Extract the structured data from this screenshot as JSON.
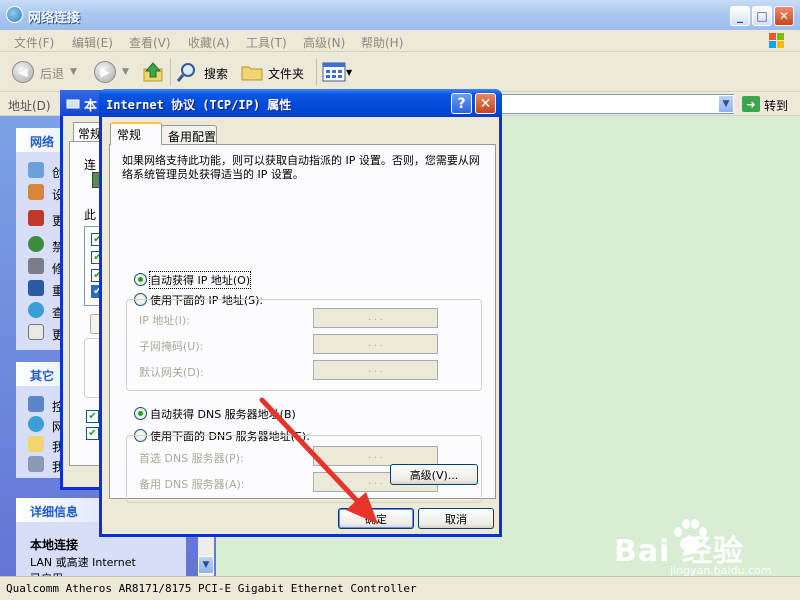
{
  "main_window": {
    "title": "网络连接",
    "menu": [
      "文件(F)",
      "编辑(E)",
      "查看(V)",
      "收藏(A)",
      "工具(T)",
      "高级(N)",
      "帮助(H)"
    ],
    "toolbar": {
      "back": "后退",
      "search": "搜索",
      "folders": "文件夹"
    },
    "address": {
      "label": "地址(D)",
      "value": "",
      "go": "转到"
    },
    "left_pane": {
      "network_tasks_title": "网络",
      "network_tasks_items": [
        "创",
        "设",
        "更",
        "禁",
        "修",
        "重",
        "查",
        "更"
      ],
      "other_places_title": "其它",
      "other_places_items": [
        "控",
        "网",
        "我",
        "我"
      ],
      "details_title": "详细信息",
      "details_name": "本地连接",
      "details_type": "LAN 或高速 Internet",
      "details_extra": "已启用"
    },
    "status_bar": "Qualcomm Atheros AR8171/8175 PCI-E Gigabit Ethernet Controller"
  },
  "back_dialog": {
    "title": "本",
    "tab": "常规",
    "connect_using": "连",
    "components_label": "此"
  },
  "dialog": {
    "title": "Internet 协议 (TCP/IP) 属性",
    "help": "?",
    "close": "✕",
    "tabs": [
      "常规",
      "备用配置"
    ],
    "intro": "如果网络支持此功能，则可以获取自动指派的 IP 设置。否则，您需要从网络系统管理员处获得适当的 IP 设置。",
    "ip_auto": "自动获得 IP 地址(O)",
    "ip_manual": "使用下面的 IP 地址(S):",
    "ip_fields": [
      {
        "label": "IP 地址(I):",
        "value": ". . ."
      },
      {
        "label": "子网掩码(U):",
        "value": ". . ."
      },
      {
        "label": "默认网关(D):",
        "value": ". . ."
      }
    ],
    "dns_auto": "自动获得 DNS 服务器地址(B)",
    "dns_manual": "使用下面的 DNS 服务器地址(E):",
    "dns_fields": [
      {
        "label": "首选 DNS 服务器(P):",
        "value": ". . ."
      },
      {
        "label": "备用 DNS 服务器(A):",
        "value": ". . ."
      }
    ],
    "advanced": "高级(V)...",
    "ok": "确定",
    "cancel": "取消",
    "selected": {
      "ip": "auto",
      "dns": "auto"
    }
  },
  "watermark": {
    "brand": "Bai 经验",
    "url": "jingyan.baidu.com"
  },
  "colors": {
    "xp_blue": "#0046d6",
    "arrow_red": "#e8322a",
    "content_bg": "#d8edd4",
    "radio_green": "#21a121"
  },
  "icons": [
    "network-connections-icon",
    "back-arrow-icon",
    "forward-arrow-icon",
    "up-folder-icon",
    "search-icon",
    "folders-icon",
    "views-icon",
    "go-icon",
    "windows-logo-icon",
    "help-icon",
    "close-icon"
  ]
}
